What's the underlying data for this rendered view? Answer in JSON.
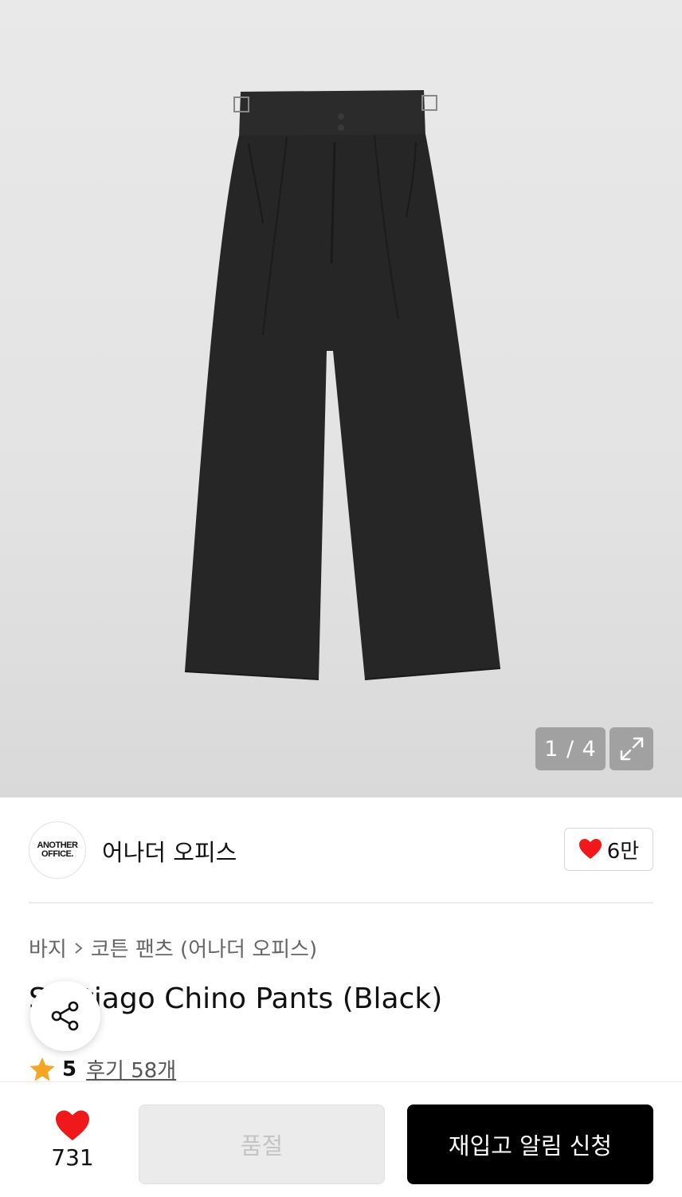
{
  "gallery": {
    "counter": "1 / 4"
  },
  "brand": {
    "logo_line1": "ANOTHER",
    "logo_line2": "OFFICE.",
    "name": "어나더 오피스",
    "like_count": "6만"
  },
  "breadcrumb": {
    "category": "바지",
    "subcategory": "코튼 팬츠 (어나더 오피스)"
  },
  "product": {
    "title": "Santiago Chino Pants (Black)"
  },
  "rating": {
    "score": "5",
    "reviews": "후기 58개"
  },
  "bottom_bar": {
    "wish_count": "731",
    "soldout_label": "품절",
    "restock_label": "재입고 알림 신청"
  },
  "colors": {
    "accent_heart": "#f01818",
    "star": "#f5a623",
    "primary_button": "#000000"
  },
  "icons": [
    "expand-icon",
    "heart-icon",
    "chevron-right-icon",
    "share-icon",
    "star-icon"
  ]
}
